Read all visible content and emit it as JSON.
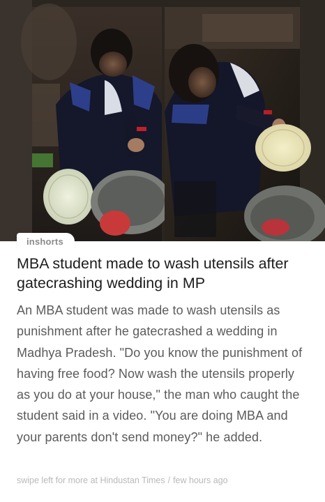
{
  "source": {
    "name": "inshorts"
  },
  "article": {
    "headline": "MBA student made to wash utensils after gatecrashing wedding in MP",
    "body": "An MBA student was made to wash utensils as punishment after he gatecrashed a wedding in Madhya Pradesh. \"Do you know the punishment of having free food? Now wash the utensils properly as you do at your house,\" the man who caught the student said in a video. \"You are doing MBA and your parents don't send money?\" he added."
  },
  "footer": {
    "swipe_text": "swipe left for more at Hindustan Times",
    "separator": "/",
    "time": "few hours ago"
  },
  "colors": {
    "headline": "#1c1c1c",
    "body": "#5b5b5b",
    "footer": "#b9b9b9",
    "tag": "#8a8a8a"
  }
}
